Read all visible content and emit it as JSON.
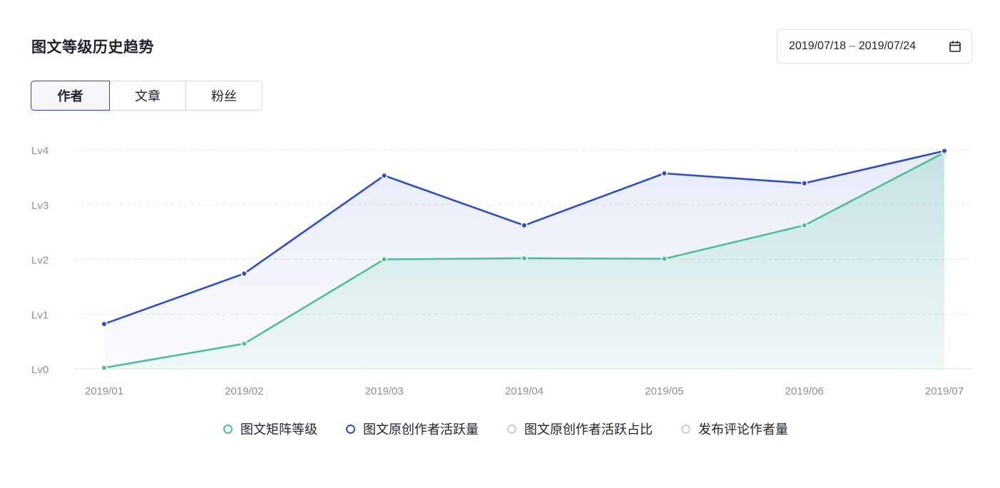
{
  "header": {
    "title": "图文等级历史趋势",
    "date_start": "2019/07/18",
    "date_sep": "–",
    "date_end": "2019/07/24",
    "calendar_icon": "calendar-icon"
  },
  "tabs": [
    {
      "label": "作者",
      "active": true
    },
    {
      "label": "文章",
      "active": false
    },
    {
      "label": "粉丝",
      "active": false
    }
  ],
  "colors": {
    "green": "#4cbf98",
    "blue": "#2c4dc6",
    "grid": "#e6e8ec",
    "axis_text": "#8a8f99",
    "legend_off": "#d9d9d9"
  },
  "chart_data": {
    "type": "area",
    "categories": [
      "2019/01",
      "2019/02",
      "2019/03",
      "2019/04",
      "2019/05",
      "2019/06",
      "2019/07"
    ],
    "y_ticks": [
      "Lv0",
      "Lv1",
      "Lv2",
      "Lv3",
      "Lv4"
    ],
    "ylim": [
      0,
      4
    ],
    "grid": true,
    "legend_position": "bottom",
    "series": [
      {
        "name": "图文矩阵等级",
        "values": [
          0.02,
          0.46,
          2.0,
          2.02,
          2.01,
          2.62,
          3.95
        ],
        "color": "#4cbf98",
        "visible": true
      },
      {
        "name": "图文原创作者活跃量",
        "values": [
          0.82,
          1.74,
          3.53,
          2.62,
          3.57,
          3.39,
          3.98
        ],
        "color": "#2c4dc6",
        "visible": true
      },
      {
        "name": "图文原创作者活跃占比",
        "values": [],
        "color": "#d9d9d9",
        "visible": false
      },
      {
        "name": "发布评论作者量",
        "values": [],
        "color": "#d9d9d9",
        "visible": false
      }
    ]
  }
}
